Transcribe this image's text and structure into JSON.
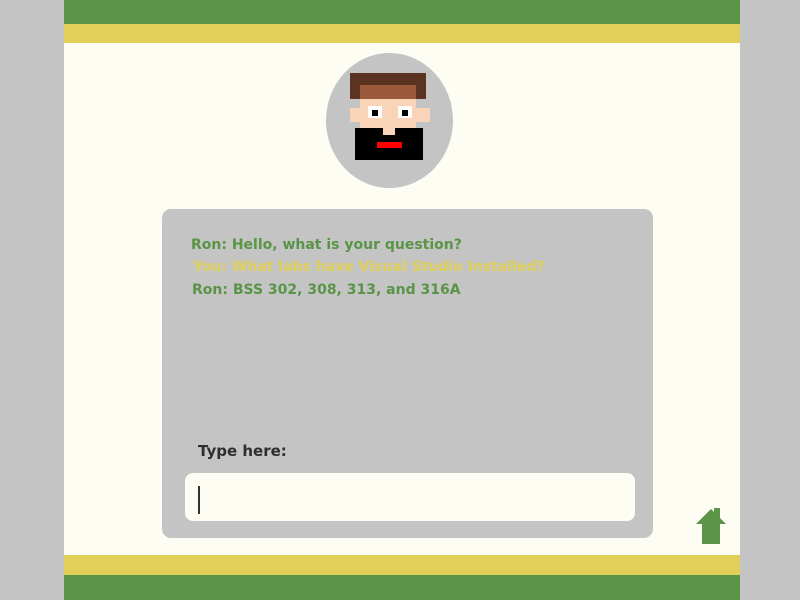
{
  "colors": {
    "brand_green": "#5a9446",
    "brand_yellow": "#e0d05a",
    "panel_gray": "#c4c4c4",
    "background": "#fdfdf4"
  },
  "avatar": {
    "icon": "pixel-face-avatar"
  },
  "chat": {
    "messages": [
      {
        "speaker": "Ron",
        "text": "Ron: Hello, what is your question?"
      },
      {
        "speaker": "You",
        "text": "You: What labs have Visual Studio Installed?"
      },
      {
        "speaker": "Ron",
        "text": "Ron: BSS 302, 308, 313, and 316A"
      }
    ],
    "input_label": "Type here:",
    "input_value": ""
  },
  "nav": {
    "home_icon": "home-icon"
  }
}
